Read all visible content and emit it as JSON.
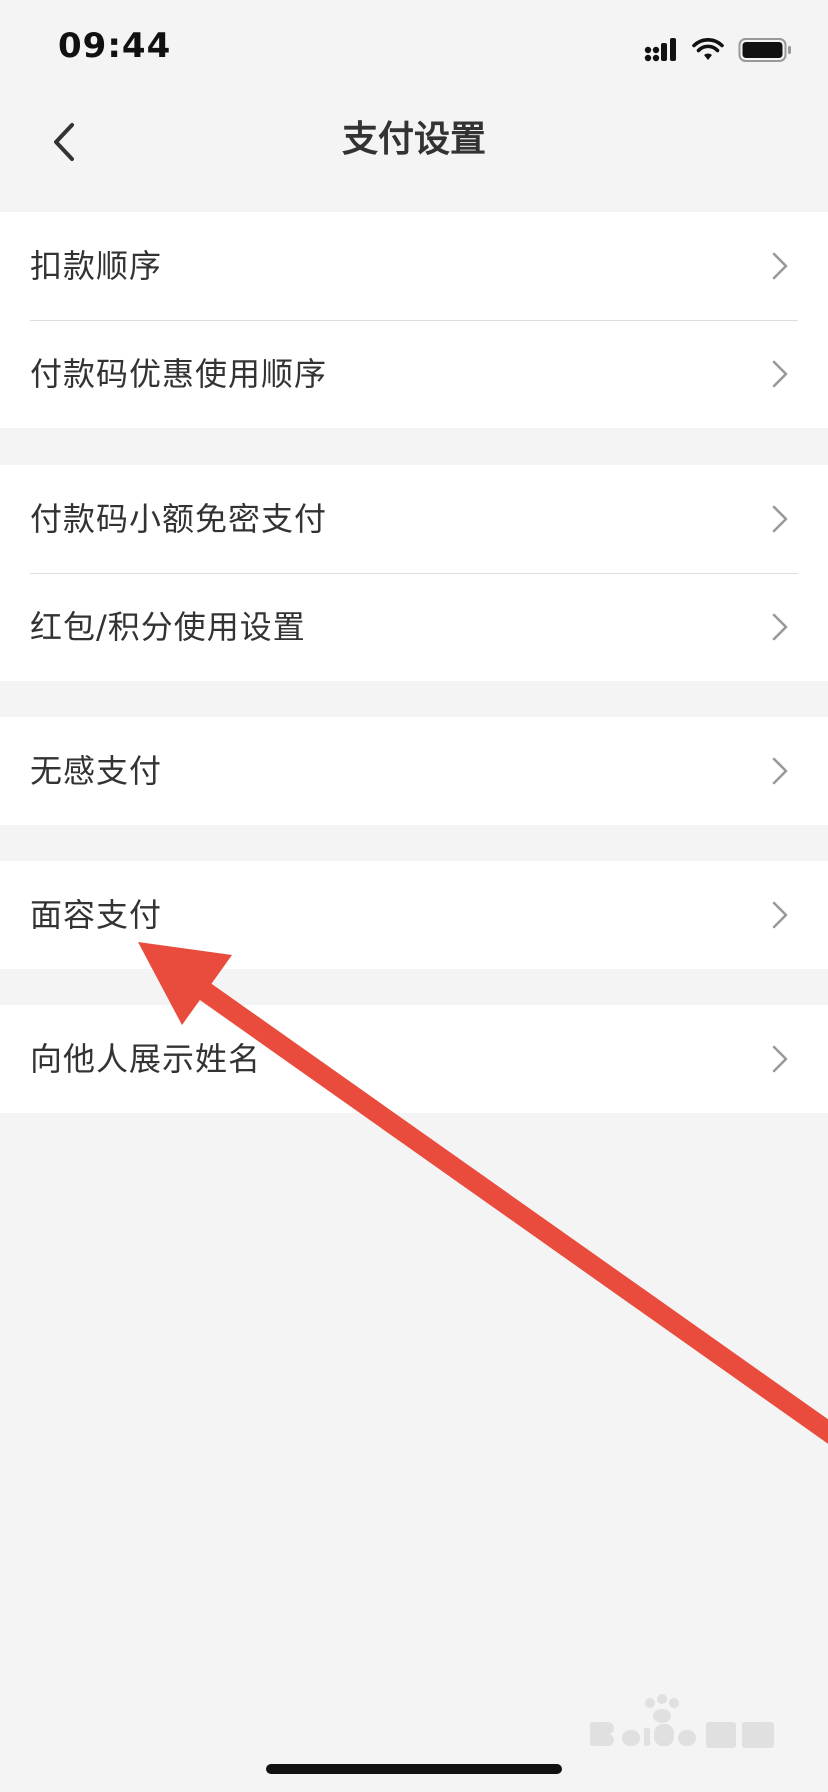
{
  "status_bar": {
    "time": "09:44"
  },
  "nav": {
    "title": "支付设置"
  },
  "groups": [
    {
      "items": [
        {
          "label": "扣款顺序"
        },
        {
          "label": "付款码优惠使用顺序"
        }
      ]
    },
    {
      "items": [
        {
          "label": "付款码小额免密支付"
        },
        {
          "label": "红包/积分使用设置"
        }
      ]
    },
    {
      "items": [
        {
          "label": "无感支付"
        }
      ]
    },
    {
      "items": [
        {
          "label": "面容支付"
        }
      ]
    },
    {
      "items": [
        {
          "label": "向他人展示姓名"
        }
      ]
    }
  ],
  "annotation": {
    "arrow_color": "#e94c3d"
  },
  "icons": {
    "back": "chevron-left-icon",
    "row": "chevron-right-icon",
    "signal": "cellular-signal-icon",
    "wifi": "wifi-icon",
    "battery": "battery-icon"
  }
}
